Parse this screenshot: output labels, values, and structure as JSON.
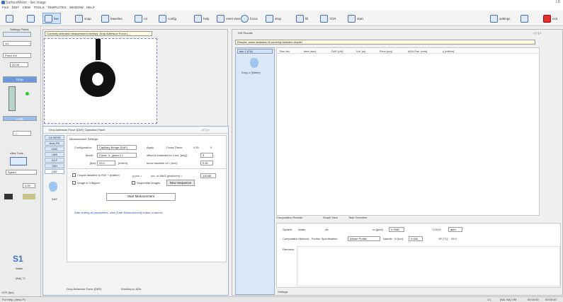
{
  "window": {
    "title": "SurfaceMeter - live image",
    "menus": [
      "FILE",
      "EDIT",
      "VIEW",
      "TOOLS",
      "TEMPLATES",
      "WINDOW",
      "HELP"
    ]
  },
  "toolbar": {
    "live": "live",
    "snap": "snap",
    "baseline": "baseline",
    "roi": "roi",
    "config": "config",
    "help": "help",
    "reset_view": "reset view",
    "focus": "focus",
    "drop": "drop",
    "fill": "fill",
    "ycr": "YCR",
    "start": "start",
    "settings": "settings",
    "exit": "exit"
  },
  "left": {
    "settings_label": "Settings Plates",
    "value1": "1/1",
    "mode": "Fixed Vol.",
    "vol": "20.00",
    "drop_btn": "Drop",
    "hub": "HUB",
    "ultra": "Ultra Tools",
    "speed": "Speed",
    "num": "0.00",
    "s1": "S1",
    "liquid": "Water",
    "temp": "(NA) °C",
    "vcr": "VCR (fps)",
    "help_status": "For Help, press F1"
  },
  "dialog": {
    "header": "Currently selected measurement method: Drop Adhesion Force (...",
    "title": "Drop Adhesion Force (DAF) Operation Panel",
    "tabs": [
      "CA SESS",
      "Auto PD",
      "CMC",
      "LMS",
      "DCF",
      "SWI",
      "DAF"
    ],
    "tab_label": "DAF",
    "settings_title": "Measurement Settings:",
    "configuration_lbl": "Configuration:",
    "configuration": "Capillary Bridge (DAF)",
    "apply": "Apply",
    "cross_theta": "Cross Theta:",
    "ct1": "0.00",
    "ct2": "0",
    "mode_lbl": "Mode:",
    "mode": "Const. V., given 2 f",
    "offset_lbl": "offset to baseline for Cont. [deg]:",
    "offset": "3",
    "fps_lbl": "[fps]:",
    "fps": "20.0",
    "fps_unit": "[mN/m]",
    "show_lbl": "show baseline of t. [sec]:",
    "show_val": "0.50",
    "couple": "Couple baseline to ROI + position",
    "image_flip": "Image is V-flipped",
    "ydist": "y-pos =",
    "ydist_unit": "um, or MAG [pixel/mm] =",
    "ydist_val": "100.86",
    "seq_lbl": "Sequential Images",
    "new_seq": "New Sequence",
    "start": "Start Measurement",
    "hint": "After setting all parameters, click [Start Measurement] button to launch.",
    "bottom_tabs": [
      "Drop Adhesion Force (DAF)",
      "Working w. AZA"
    ]
  },
  "result": {
    "title": "DM Results",
    "banner": "Results: value statistics of currently selected droplet",
    "side_tab": "ask 1 (CA)",
    "drop": "Drop-1 (Water)",
    "columns": [
      "Run-No.",
      "time [sec]",
      "DAF [uN]",
      "Vol. [ul]",
      "Error [um]",
      "AZA-Pos. [mm]",
      "y [mN/m]"
    ],
    "lower_tabs": [
      "Computation Results",
      "Graph View",
      "Task Overview"
    ],
    "system_lbl": "System:",
    "system_val": "Water",
    "air": "Air",
    "ro_lbl": "ro [g/ml]:",
    "ro_val": "0.9982",
    "lochy": "LOCH:",
    "lochy_val": "alert",
    "comp_lbl": "Computation Method - Further Specification:",
    "comp_val": "Whole Profile",
    "needle_lbl": "Needle - D [km]:",
    "needle_val": "0.000",
    "sf_lbl": "SF [°C]:",
    "sf_val": "25.0",
    "remarks": "Remarks:",
    "settings_tab": "Settings"
  },
  "statusbar": {
    "help": "For Help, press F1",
    "s1": "1:1",
    "s2": "(NA, NA) VM",
    "s3": "00:00:00",
    "s4": "00:00:00"
  }
}
